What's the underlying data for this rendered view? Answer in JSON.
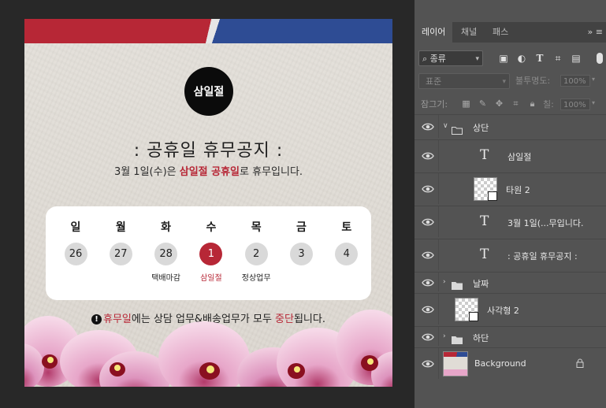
{
  "artboard": {
    "badge": "삼일절",
    "title": ": 공휴일 휴무공지 :",
    "subtitle": {
      "prefix": "3월 1일(수)은 ",
      "highlight": "삼일절 공휴일",
      "suffix": "로 휴무입니다."
    },
    "calendar": [
      {
        "day": "일",
        "date": "26",
        "note": "",
        "active": false
      },
      {
        "day": "월",
        "date": "27",
        "note": "",
        "active": false
      },
      {
        "day": "화",
        "date": "28",
        "note": "택배마감",
        "active": false
      },
      {
        "day": "수",
        "date": "1",
        "note": "삼일절",
        "active": true
      },
      {
        "day": "목",
        "date": "2",
        "note": "정상업무",
        "active": false
      },
      {
        "day": "금",
        "date": "3",
        "note": "",
        "active": false
      },
      {
        "day": "토",
        "date": "4",
        "note": "",
        "active": false
      }
    ],
    "notice": {
      "icon": "!",
      "part1": "휴무일",
      "part2": "에는 상담 업무&배송업무가 모두 ",
      "part3": "중단",
      "part4": "됩니다."
    },
    "colors": {
      "red": "#b72736",
      "blue": "#2e4c94",
      "paper": "#e0dcd6"
    }
  },
  "panel": {
    "tabs": [
      "레이어",
      "채널",
      "패스"
    ],
    "active_tab": "레이어",
    "menu_glyph": "»  ≡",
    "filter": {
      "kind": "종류",
      "icons": [
        "image-filter-icon",
        "adjustment-filter-icon",
        "type-filter-icon",
        "shape-filter-icon",
        "smart-object-filter-icon"
      ]
    },
    "blend_mode": "표준",
    "opacity_label": "불투명도:",
    "opacity_value": "100%",
    "lock_label": "잠그기:",
    "fill_label": "칠:",
    "fill_value": "100%",
    "layers": [
      {
        "name": "상단",
        "kind": "group",
        "expanded": true,
        "indent": 0
      },
      {
        "name": "삼일절",
        "kind": "text",
        "indent": 1
      },
      {
        "name": "타원 2",
        "kind": "shape",
        "indent": 1
      },
      {
        "name": "3월 1일(...무입니다.",
        "kind": "text",
        "indent": 1
      },
      {
        "name": ": 공휴일  휴무공지 :",
        "kind": "text",
        "indent": 1
      },
      {
        "name": "날짜",
        "kind": "group",
        "expanded": false,
        "indent": 0
      },
      {
        "name": "사각형 2",
        "kind": "shape",
        "indent": 0
      },
      {
        "name": "하단",
        "kind": "group",
        "expanded": false,
        "indent": 0
      },
      {
        "name": "Background",
        "kind": "background",
        "indent": 0,
        "locked": true
      }
    ]
  }
}
